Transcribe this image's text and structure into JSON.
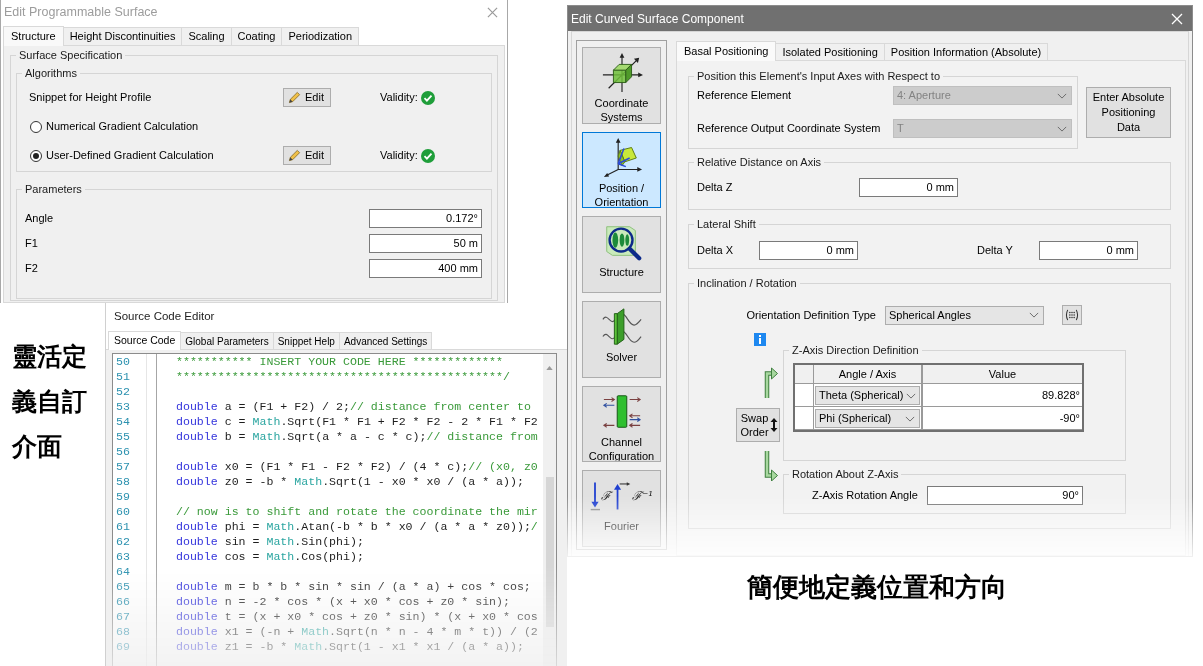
{
  "programmable_surface_dialog": {
    "title": "Edit Programmable Surface",
    "tabs": [
      {
        "label": "Structure",
        "selected": true
      },
      {
        "label": "Height Discontinuities",
        "selected": false
      },
      {
        "label": "Scaling",
        "selected": false
      },
      {
        "label": "Coating",
        "selected": false
      },
      {
        "label": "Periodization",
        "selected": false
      }
    ],
    "surface_specification": {
      "title": "Surface Specification",
      "algorithms": {
        "title": "Algorithms",
        "rows": [
          {
            "kind": "label",
            "label": "Snippet for Height Profile",
            "button": "Edit",
            "validity": "Validity:",
            "valid": true
          },
          {
            "kind": "radio",
            "label": "Numerical Gradient Calculation",
            "selected": false
          },
          {
            "kind": "radio",
            "label": "User-Defined Gradient Calculation",
            "selected": true,
            "button": "Edit",
            "validity": "Validity:",
            "valid": true
          }
        ]
      },
      "parameters": {
        "title": "Parameters",
        "fields": [
          {
            "label": "Angle",
            "value": "0.172°"
          },
          {
            "label": "F1",
            "value": "50 m"
          },
          {
            "label": "F2",
            "value": "400 mm"
          }
        ]
      }
    }
  },
  "side_caption": "靈活定義自訂介面",
  "source_code_editor": {
    "title": "Source Code Editor",
    "tabs": [
      {
        "label": "Source Code",
        "selected": true
      },
      {
        "label": "Global Parameters",
        "selected": false
      },
      {
        "label": "Snippet Help",
        "selected": false
      },
      {
        "label": "Advanced Settings",
        "selected": false
      }
    ],
    "lines": [
      {
        "number": "50",
        "tokens": [
          {
            "kind": "comment",
            "text": "*********** INSERT YOUR CODE HERE *************"
          }
        ]
      },
      {
        "number": "51",
        "tokens": [
          {
            "kind": "comment",
            "text": "***********************************************/"
          }
        ]
      },
      {
        "number": "52"
      },
      {
        "number": "53",
        "tokens": [
          {
            "kind": "keyword",
            "text": "double"
          },
          {
            "kind": "plain",
            "text": " a = (F1 + F2) / 2;"
          },
          {
            "kind": "comment",
            "text": "// distance from center to"
          }
        ]
      },
      {
        "number": "54",
        "tokens": [
          {
            "kind": "keyword",
            "text": "double"
          },
          {
            "kind": "plain",
            "text": " c = "
          },
          {
            "kind": "class",
            "text": "Math"
          },
          {
            "kind": "plain",
            "text": ".Sqrt(F1 * F1 + F2 * F2 - 2 * F1 * F2"
          }
        ]
      },
      {
        "number": "55",
        "tokens": [
          {
            "kind": "keyword",
            "text": "double"
          },
          {
            "kind": "plain",
            "text": " b = "
          },
          {
            "kind": "class",
            "text": "Math"
          },
          {
            "kind": "plain",
            "text": ".Sqrt(a * a - c * c);"
          },
          {
            "kind": "comment",
            "text": "// distance from"
          }
        ]
      },
      {
        "number": "56"
      },
      {
        "number": "57",
        "tokens": [
          {
            "kind": "keyword",
            "text": "double"
          },
          {
            "kind": "plain",
            "text": " x0 = (F1 * F1 - F2 * F2) / (4 * c);"
          },
          {
            "kind": "comment",
            "text": "// (x0, z0"
          }
        ]
      },
      {
        "number": "58",
        "tokens": [
          {
            "kind": "keyword",
            "text": "double"
          },
          {
            "kind": "plain",
            "text": " z0 = -b * "
          },
          {
            "kind": "class",
            "text": "Math"
          },
          {
            "kind": "plain",
            "text": ".Sqrt(1 - x0 * x0 / (a * a));"
          }
        ]
      },
      {
        "number": "59"
      },
      {
        "number": "60",
        "tokens": [
          {
            "kind": "comment",
            "text": "// now is to shift and rotate the coordinate the mir"
          }
        ]
      },
      {
        "number": "61",
        "tokens": [
          {
            "kind": "keyword",
            "text": "double"
          },
          {
            "kind": "plain",
            "text": " phi = "
          },
          {
            "kind": "class",
            "text": "Math"
          },
          {
            "kind": "plain",
            "text": ".Atan(-b * b * x0 / (a * a * z0));"
          },
          {
            "kind": "comment",
            "text": "/"
          }
        ]
      },
      {
        "number": "62",
        "tokens": [
          {
            "kind": "keyword",
            "text": "double"
          },
          {
            "kind": "plain",
            "text": " sin = "
          },
          {
            "kind": "class",
            "text": "Math"
          },
          {
            "kind": "plain",
            "text": ".Sin(phi);"
          }
        ]
      },
      {
        "number": "63",
        "tokens": [
          {
            "kind": "keyword",
            "text": "double"
          },
          {
            "kind": "plain",
            "text": " cos = "
          },
          {
            "kind": "class",
            "text": "Math"
          },
          {
            "kind": "plain",
            "text": ".Cos(phi);"
          }
        ]
      },
      {
        "number": "64"
      },
      {
        "number": "65",
        "tokens": [
          {
            "kind": "keyword",
            "text": "double"
          },
          {
            "kind": "plain",
            "text": " m = b * b * sin * sin / (a * a) + cos * cos;"
          }
        ]
      },
      {
        "number": "66",
        "tokens": [
          {
            "kind": "keyword",
            "text": "double"
          },
          {
            "kind": "plain",
            "text": " n = -2 * cos * (x + x0 * cos + z0 * sin);"
          }
        ]
      },
      {
        "number": "67",
        "tokens": [
          {
            "kind": "keyword",
            "text": "double"
          },
          {
            "kind": "plain",
            "text": " t = (x + x0 * cos + z0 * sin) * (x + x0 * cos"
          }
        ]
      },
      {
        "number": "68",
        "tokens": [
          {
            "kind": "keyword",
            "text": "double"
          },
          {
            "kind": "plain",
            "text": " x1 = (-n + "
          },
          {
            "kind": "class",
            "text": "Math"
          },
          {
            "kind": "plain",
            "text": ".Sqrt(n * n - 4 * m * t)) / (2"
          }
        ]
      },
      {
        "number": "69",
        "tokens": [
          {
            "kind": "keyword",
            "text": "double"
          },
          {
            "kind": "plain",
            "text": " z1 = -b * "
          },
          {
            "kind": "class",
            "text": "Math"
          },
          {
            "kind": "plain",
            "text": ".Sqrt(1 - x1 * x1 / (a * a));"
          }
        ]
      }
    ]
  },
  "curved_surface_dialog": {
    "title": "Edit Curved Surface Component",
    "sidebar": [
      {
        "label": "Coordinate Systems",
        "selected": false
      },
      {
        "label": "Position / Orientation",
        "selected": true
      },
      {
        "label": "Structure",
        "selected": false
      },
      {
        "label": "Solver",
        "selected": false
      },
      {
        "label": "Channel Configuration",
        "selected": false
      },
      {
        "label": "Fourier",
        "selected": false,
        "icon_text": [
          "ℱ",
          "ℱ⁻¹"
        ]
      }
    ],
    "tabs": [
      {
        "label": "Basal Positioning",
        "selected": true
      },
      {
        "label": "Isolated Positioning",
        "selected": false
      },
      {
        "label": "Position Information (Absolute)",
        "selected": false
      }
    ],
    "input_axes": {
      "title": "Position this Element's Input Axes with Respect to",
      "fields": [
        {
          "label": "Reference Element",
          "value": "4: Aperture",
          "disabled": true
        },
        {
          "label": "Reference Output Coordinate System",
          "value": "T",
          "disabled": true
        }
      ],
      "button": "Enter Absolute Positioning Data"
    },
    "relative_distance": {
      "title": "Relative Distance on Axis",
      "fields": [
        {
          "label": "Delta Z",
          "value": "0 mm"
        }
      ]
    },
    "lateral_shift": {
      "title": "Lateral Shift",
      "fields": [
        {
          "label": "Delta X",
          "value": "0 mm"
        },
        {
          "label": "Delta Y",
          "value": "0 mm"
        }
      ]
    },
    "inclination": {
      "title": "Inclination / Rotation",
      "orientation_type": {
        "label": "Orientation Definition Type",
        "value": "Spherical Angles"
      },
      "z_axis_direction": {
        "title": "Z-Axis Direction Definition",
        "columns": [
          "Angle / Axis",
          "Value"
        ],
        "rows": [
          {
            "axis": "Theta (Spherical)",
            "value": "89.828°"
          },
          {
            "axis": "Phi (Spherical)",
            "value": "-90°"
          }
        ]
      },
      "swap_button": "Swap Order",
      "rotation": {
        "title": "Rotation About Z-Axis",
        "label": "Z-Axis Rotation Angle",
        "value": "90°"
      }
    }
  },
  "caption": "簡便地定義位置和方向"
}
